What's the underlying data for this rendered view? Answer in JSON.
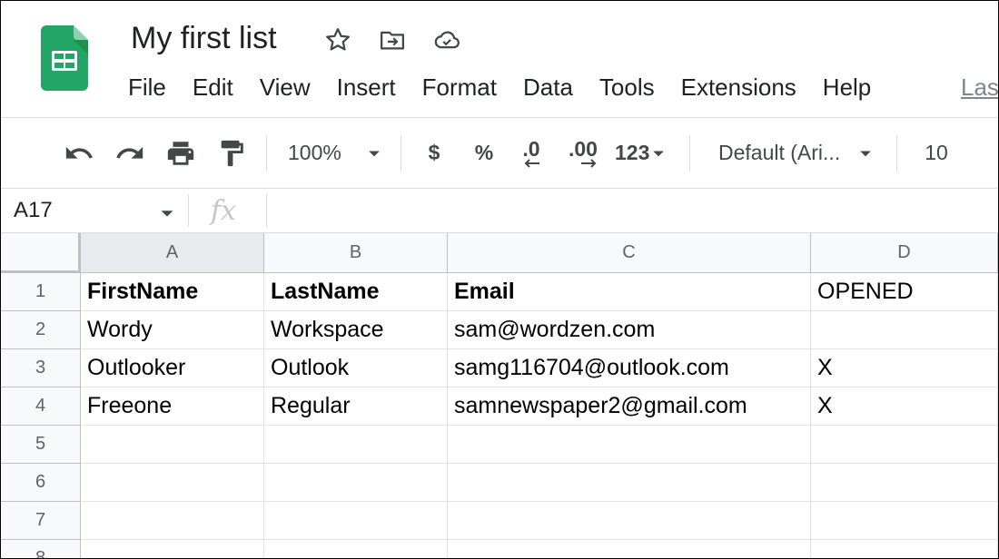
{
  "document": {
    "title": "My first list",
    "icons": [
      "star-icon",
      "move-to-folder-icon",
      "cloud-saved-icon"
    ]
  },
  "menu": [
    "File",
    "Edit",
    "View",
    "Insert",
    "Format",
    "Data",
    "Tools",
    "Extensions",
    "Help"
  ],
  "last_edit_label": "Las",
  "toolbar": {
    "zoom": "100%",
    "currency": "$",
    "percent": "%",
    "decrease_decimal": ".0",
    "increase_decimal": ".00",
    "number_format": "123",
    "font": "Default (Ari...",
    "font_size": "10",
    "icons": [
      "undo-icon",
      "redo-icon",
      "print-icon",
      "paint-format-icon"
    ]
  },
  "formula_bar": {
    "name_box": "A17",
    "fx_label": "fx",
    "formula": ""
  },
  "sheet": {
    "selected_column": "A",
    "columns": [
      "A",
      "B",
      "C",
      "D"
    ],
    "row_numbers": [
      "1",
      "2",
      "3",
      "4",
      "5",
      "6",
      "7",
      "8"
    ],
    "rows": [
      [
        "FirstName",
        "LastName",
        "Email",
        "OPENED"
      ],
      [
        "Wordy",
        "Workspace",
        "sam@wordzen.com",
        ""
      ],
      [
        "Outlooker",
        "Outlook",
        "samg116704@outlook.com",
        "X"
      ],
      [
        "Freeone",
        "Regular",
        "samnewspaper2@gmail.com",
        "X"
      ],
      [
        "",
        "",
        "",
        ""
      ],
      [
        "",
        "",
        "",
        ""
      ],
      [
        "",
        "",
        "",
        ""
      ],
      [
        "",
        "",
        "",
        ""
      ]
    ],
    "bold_header_row": true
  },
  "colors": {
    "logo_green": "#23a566",
    "logo_dark": "#188038",
    "gridline": "#e2e3e3",
    "header_bg": "#f8f9fa",
    "selected_header_bg": "#e8eaed"
  }
}
